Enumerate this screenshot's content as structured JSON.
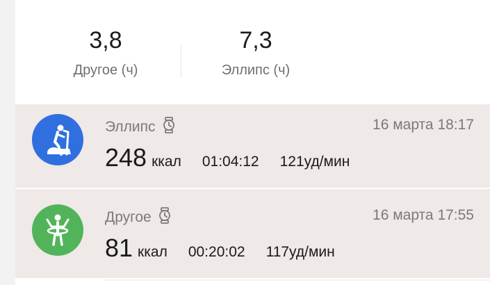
{
  "summary": [
    {
      "value": "3,8",
      "label": "Другое (ч)"
    },
    {
      "value": "7,3",
      "label": "Эллипс (ч)"
    }
  ],
  "workouts": [
    {
      "name": "Эллипс",
      "date": "16 марта 18:17",
      "kcal": "248",
      "kcal_unit": "ккал",
      "duration": "01:04:12",
      "heart_rate": "121уд/мин",
      "icon": "elliptical-icon",
      "color": "#2f6fe0"
    },
    {
      "name": "Другое",
      "date": "16 марта 17:55",
      "kcal": "81",
      "kcal_unit": "ккал",
      "duration": "00:20:02",
      "heart_rate": "117уд/мин",
      "icon": "other-activity-icon",
      "color": "#52b45a"
    }
  ],
  "colors": {
    "row_bg": "#efe9e7",
    "text_secondary": "#7a7a7a"
  }
}
